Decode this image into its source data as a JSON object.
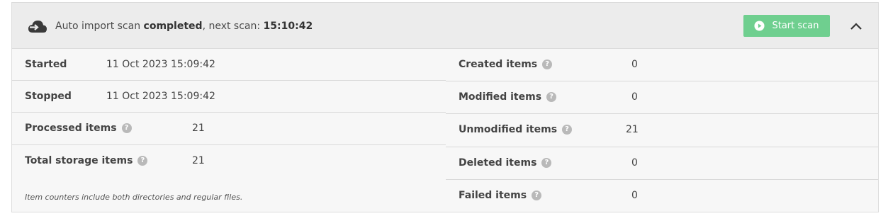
{
  "header": {
    "status_prefix": "Auto import scan ",
    "status_state": "completed",
    "status_middle": ", next scan: ",
    "next_scan_time": "15:10:42",
    "start_button_label": "Start scan",
    "icons": {
      "status": "cloud-import-icon",
      "start": "play-circle-icon",
      "collapse": "chevron-up-icon"
    },
    "colors": {
      "start_button": "#6fcf8f"
    }
  },
  "left": {
    "started_label": "Started",
    "started_value": "11 Oct 2023 15:09:42",
    "stopped_label": "Stopped",
    "stopped_value": "11 Oct 2023 15:09:42",
    "processed_label": "Processed items",
    "processed_value": "21",
    "total_label": "Total storage items",
    "total_value": "21",
    "note": "Item counters include both directories and regular files."
  },
  "right": {
    "created_label": "Created items",
    "created_value": "0",
    "modified_label": "Modified items",
    "modified_value": "0",
    "unmodified_label": "Unmodified items",
    "unmodified_value": "21",
    "deleted_label": "Deleted items",
    "deleted_value": "0",
    "failed_label": "Failed items",
    "failed_value": "0"
  },
  "help_glyph": "?"
}
